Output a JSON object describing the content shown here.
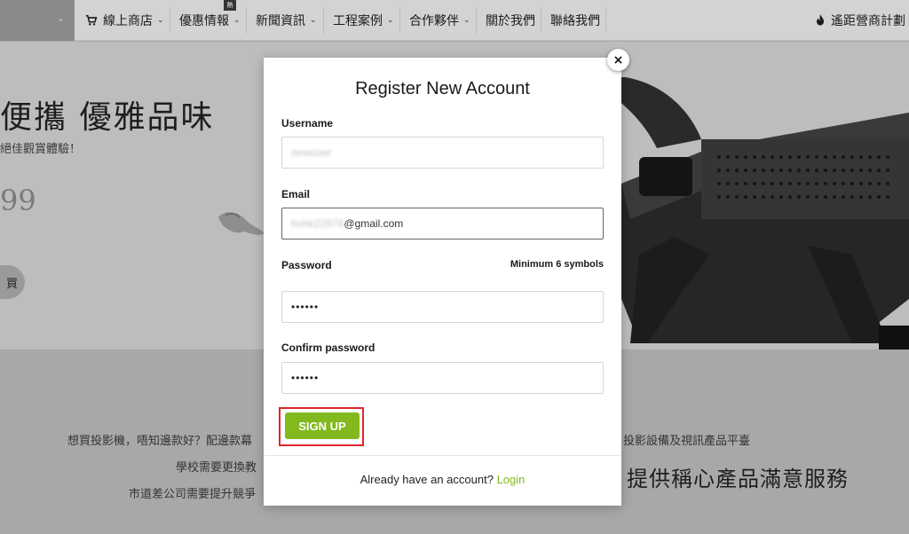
{
  "nav": {
    "items": [
      {
        "label": "線上商店",
        "caret": true
      },
      {
        "label": "優惠情報",
        "caret": true,
        "badge": "熱"
      },
      {
        "label": "新聞資訊",
        "caret": true
      },
      {
        "label": "工程案例",
        "caret": true
      },
      {
        "label": "合作夥伴",
        "caret": true
      },
      {
        "label": "關於我們",
        "caret": false
      },
      {
        "label": "聯絡我們",
        "caret": false
      }
    ],
    "right_label": "遙距營商計劃",
    "caret_glyph": "⌄"
  },
  "hero": {
    "title": "便攜 優雅品味",
    "subtitle": "絕佳觀賞體驗！",
    "price": "99",
    "button_label": "買"
  },
  "lower": {
    "line1_left": "想買投影機，唔知邊款好？配邊款幕",
    "line1_right": "投影設備及視訊產品平臺",
    "line2": "學校需要更換教",
    "line3": "市道差公司需要提升競爭",
    "big_right": "提供稱心產品滿意服務"
  },
  "modal": {
    "close_symbol": "×",
    "title": "Register New Account",
    "username_label": "Username",
    "username_value": "newuser",
    "email_label": "Email",
    "email_value_hidden": "hohk22876",
    "email_value_visible": "@gmail.com",
    "password_label": "Password",
    "password_hint": "Minimum 6 symbols",
    "password_value": "••••••",
    "confirm_label": "Confirm password",
    "confirm_value": "••••••",
    "signup_label": "SIGN UP",
    "have_account_text": "Already have an account?",
    "login_link": "Login"
  },
  "colors": {
    "accent_green": "#82b91e",
    "highlight_red": "#e0262b"
  }
}
